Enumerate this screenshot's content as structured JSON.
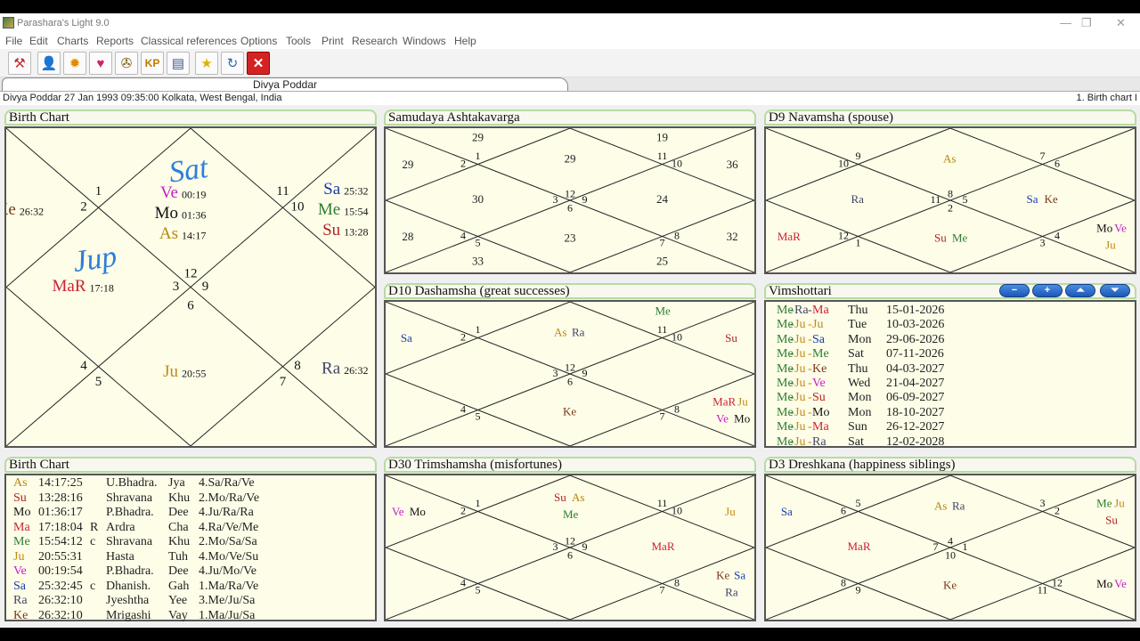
{
  "window": {
    "title": "Parashara's Light 9.0",
    "restore_glyph": "❐",
    "close_glyph": "✕"
  },
  "menu": [
    "File",
    "Edit",
    "Charts",
    "Reports",
    "Classical references",
    "Options",
    "Tools",
    "Print",
    "Research",
    "Windows",
    "Help"
  ],
  "toolbar": [
    {
      "name": "tools-icon",
      "glyph": "⚒"
    },
    {
      "name": "person-icon",
      "glyph": "👤"
    },
    {
      "name": "sun-burst-icon",
      "glyph": "✹"
    },
    {
      "name": "heart-icon",
      "glyph": "♥"
    },
    {
      "name": "wheel-icon",
      "glyph": "✇"
    },
    {
      "name": "kp-icon",
      "glyph": "KP"
    },
    {
      "name": "report-icon",
      "glyph": "▤"
    },
    {
      "name": "star-icon",
      "glyph": "★"
    },
    {
      "name": "refresh-icon",
      "glyph": "↻"
    },
    {
      "name": "close-icon",
      "glyph": "✕"
    }
  ],
  "tab": {
    "label": "Divya Poddar"
  },
  "infobar": {
    "left": "Divya Poddar 27 Jan 1993 09:35:00  Kolkata, West Bengal, India",
    "right": "1. Birth chart I"
  },
  "colors": {
    "As": "#b8860b",
    "Su": "#b22222",
    "Mo": "#111111",
    "Ma": "#cc2233",
    "Me": "#2e7d32",
    "Ju": "#c28a14",
    "Ve": "#c51ec5",
    "Sa": "#1a3aa8",
    "Ra": "#444466",
    "Ke": "#7a3a1a"
  },
  "panels": {
    "birth_chart": {
      "title": "Birth Chart",
      "houses": [
        {
          "h": 1,
          "n": "12"
        },
        {
          "h": 2,
          "n": "1"
        },
        {
          "h": 3,
          "n": "2"
        },
        {
          "h": 4,
          "n": "3"
        },
        {
          "h": 5,
          "n": "4"
        },
        {
          "h": 6,
          "n": "5"
        },
        {
          "h": 7,
          "n": "6"
        },
        {
          "h": 8,
          "n": "7"
        },
        {
          "h": 9,
          "n": "8"
        },
        {
          "h": 10,
          "n": "9"
        },
        {
          "h": 11,
          "n": "10"
        },
        {
          "h": 12,
          "n": "11"
        }
      ],
      "planets": [
        {
          "h": 1,
          "p": "Ve",
          "deg": "00:19"
        },
        {
          "h": 1,
          "p": "Mo",
          "deg": "01:36"
        },
        {
          "h": 1,
          "p": "As",
          "deg": "14:17"
        },
        {
          "h": 3,
          "p": "Ke",
          "deg": "26:32"
        },
        {
          "h": 4,
          "p": "MaR",
          "deg": "17:18",
          "c": "Ma"
        },
        {
          "h": 7,
          "p": "Ju",
          "deg": "20:55"
        },
        {
          "h": 9,
          "p": "Ra",
          "deg": "26:32"
        },
        {
          "h": 11,
          "p": "Sa",
          "deg": "25:32"
        },
        {
          "h": 11,
          "p": "Me",
          "deg": "15:54"
        },
        {
          "h": 11,
          "p": "Su",
          "deg": "13:28"
        }
      ],
      "annotations": [
        "Sat",
        "Jup"
      ]
    },
    "samudaya": {
      "title": "Samudaya Ashtakavarga",
      "houses": [
        {
          "h": 1,
          "n": "12"
        },
        {
          "h": 2,
          "n": "1"
        },
        {
          "h": 3,
          "n": "2"
        },
        {
          "h": 4,
          "n": "3"
        },
        {
          "h": 5,
          "n": "4"
        },
        {
          "h": 6,
          "n": "5"
        },
        {
          "h": 7,
          "n": "6"
        },
        {
          "h": 8,
          "n": "7"
        },
        {
          "h": 9,
          "n": "8"
        },
        {
          "h": 10,
          "n": "9"
        },
        {
          "h": 11,
          "n": "10"
        },
        {
          "h": 12,
          "n": "11"
        }
      ],
      "values": [
        {
          "h": 1,
          "v": "29"
        },
        {
          "h": 2,
          "v": "29"
        },
        {
          "h": 3,
          "v": "29"
        },
        {
          "h": 4,
          "v": "30"
        },
        {
          "h": 5,
          "v": "28"
        },
        {
          "h": 6,
          "v": "33"
        },
        {
          "h": 7,
          "v": "23"
        },
        {
          "h": 8,
          "v": "25"
        },
        {
          "h": 9,
          "v": "32"
        },
        {
          "h": 10,
          "v": "24"
        },
        {
          "h": 11,
          "v": "36"
        },
        {
          "h": 12,
          "v": "19"
        }
      ]
    },
    "d9": {
      "title": "D9 Navamsha  (spouse)",
      "houses": [
        {
          "h": 1,
          "n": "8"
        },
        {
          "h": 2,
          "n": "9"
        },
        {
          "h": 3,
          "n": "10"
        },
        {
          "h": 4,
          "n": "11"
        },
        {
          "h": 5,
          "n": "12"
        },
        {
          "h": 6,
          "n": "1"
        },
        {
          "h": 7,
          "n": "2"
        },
        {
          "h": 8,
          "n": "3"
        },
        {
          "h": 9,
          "n": "4"
        },
        {
          "h": 10,
          "n": "5"
        },
        {
          "h": 11,
          "n": "6"
        },
        {
          "h": 12,
          "n": "7"
        }
      ],
      "planets": [
        {
          "h": 1,
          "items": [
            "As"
          ]
        },
        {
          "h": 4,
          "items": [
            "Ra"
          ]
        },
        {
          "h": 5,
          "items": [
            "MaR"
          ]
        },
        {
          "h": 7,
          "items": [
            "Su",
            "Me"
          ]
        },
        {
          "h": 9,
          "items": [
            "Mo",
            "Ve",
            "Ju"
          ]
        },
        {
          "h": 10,
          "items": [
            "Sa",
            "Ke"
          ]
        }
      ]
    },
    "d10": {
      "title": "D10 Dashamsha  (great successes)",
      "houses": [
        {
          "h": 1,
          "n": "12"
        },
        {
          "h": 2,
          "n": "1"
        },
        {
          "h": 3,
          "n": "2"
        },
        {
          "h": 4,
          "n": "3"
        },
        {
          "h": 5,
          "n": "4"
        },
        {
          "h": 6,
          "n": "5"
        },
        {
          "h": 7,
          "n": "6"
        },
        {
          "h": 8,
          "n": "7"
        },
        {
          "h": 9,
          "n": "8"
        },
        {
          "h": 10,
          "n": "9"
        },
        {
          "h": 11,
          "n": "10"
        },
        {
          "h": 12,
          "n": "11"
        }
      ],
      "planets": [
        {
          "h": 1,
          "items": [
            "As",
            "Ra"
          ]
        },
        {
          "h": 3,
          "items": [
            "Sa"
          ]
        },
        {
          "h": 7,
          "items": [
            "Ke"
          ]
        },
        {
          "h": 9,
          "items": [
            "MaR",
            "Ju",
            "Ve",
            "Mo"
          ]
        },
        {
          "h": 11,
          "items": [
            "Su"
          ]
        },
        {
          "h": 12,
          "items": [
            "Me"
          ]
        }
      ]
    },
    "vimshottari": {
      "title": "Vimshottari",
      "buttons": [
        "−",
        "+",
        "⏶",
        "⏷"
      ],
      "rows": [
        {
          "p": [
            "Me",
            "Ra",
            "Ma"
          ],
          "day": "Thu",
          "date": "15-01-2026"
        },
        {
          "p": [
            "Me",
            "Ju",
            "Ju"
          ],
          "day": "Tue",
          "date": "10-03-2026"
        },
        {
          "p": [
            "Me",
            "Ju",
            "Sa"
          ],
          "day": "Mon",
          "date": "29-06-2026"
        },
        {
          "p": [
            "Me",
            "Ju",
            "Me"
          ],
          "day": "Sat",
          "date": "07-11-2026"
        },
        {
          "p": [
            "Me",
            "Ju",
            "Ke"
          ],
          "day": "Thu",
          "date": "04-03-2027"
        },
        {
          "p": [
            "Me",
            "Ju",
            "Ve"
          ],
          "day": "Wed",
          "date": "21-04-2027"
        },
        {
          "p": [
            "Me",
            "Ju",
            "Su"
          ],
          "day": "Mon",
          "date": "06-09-2027"
        },
        {
          "p": [
            "Me",
            "Ju",
            "Mo"
          ],
          "day": "Mon",
          "date": "18-10-2027"
        },
        {
          "p": [
            "Me",
            "Ju",
            "Ma"
          ],
          "day": "Sun",
          "date": "26-12-2027"
        },
        {
          "p": [
            "Me",
            "Ju",
            "Ra"
          ],
          "day": "Sat",
          "date": "12-02-2028"
        }
      ]
    },
    "positions": {
      "title": "Birth Chart",
      "rows": [
        {
          "p": "As",
          "deg": "14:17:25",
          "flag": "",
          "nak": "U.Bhadra.",
          "lord": "Jya",
          "pada": "4.Sa/Ra/Ve"
        },
        {
          "p": "Su",
          "deg": "13:28:16",
          "flag": "",
          "nak": "Shravana",
          "lord": "Khu",
          "pada": "2.Mo/Ra/Ve"
        },
        {
          "p": "Mo",
          "deg": "01:36:17",
          "flag": "",
          "nak": "P.Bhadra.",
          "lord": "Dee",
          "pada": "4.Ju/Ra/Ra"
        },
        {
          "p": "Ma",
          "deg": "17:18:04",
          "flag": "R",
          "nak": "Ardra",
          "lord": "Cha",
          "pada": "4.Ra/Ve/Me"
        },
        {
          "p": "Me",
          "deg": "15:54:12",
          "flag": "c",
          "nak": "Shravana",
          "lord": "Khu",
          "pada": "2.Mo/Sa/Sa"
        },
        {
          "p": "Ju",
          "deg": "20:55:31",
          "flag": "",
          "nak": "Hasta",
          "lord": "Tuh",
          "pada": "4.Mo/Ve/Su"
        },
        {
          "p": "Ve",
          "deg": "00:19:54",
          "flag": "",
          "nak": "P.Bhadra.",
          "lord": "Dee",
          "pada": "4.Ju/Mo/Ve"
        },
        {
          "p": "Sa",
          "deg": "25:32:45",
          "flag": "c",
          "nak": "Dhanish.",
          "lord": "Gah",
          "pada": "1.Ma/Ra/Ve"
        },
        {
          "p": "Ra",
          "deg": "26:32:10",
          "flag": "",
          "nak": "Jyeshtha",
          "lord": "Yee",
          "pada": "3.Me/Ju/Sa"
        },
        {
          "p": "Ke",
          "deg": "26:32:10",
          "flag": "",
          "nak": "Mrigashi",
          "lord": "Vay",
          "pada": "1.Ma/Ju/Sa"
        }
      ]
    },
    "d30": {
      "title": "D30 Trimshamsha  (misfortunes)",
      "houses": [
        {
          "h": 1,
          "n": "12"
        },
        {
          "h": 2,
          "n": "1"
        },
        {
          "h": 3,
          "n": "2"
        },
        {
          "h": 4,
          "n": "3"
        },
        {
          "h": 5,
          "n": "4"
        },
        {
          "h": 6,
          "n": "5"
        },
        {
          "h": 7,
          "n": "6"
        },
        {
          "h": 8,
          "n": "7"
        },
        {
          "h": 9,
          "n": "8"
        },
        {
          "h": 10,
          "n": "9"
        },
        {
          "h": 11,
          "n": "10"
        },
        {
          "h": 12,
          "n": "11"
        }
      ],
      "planets": [
        {
          "h": 1,
          "items": [
            "Su",
            "As",
            "Me"
          ]
        },
        {
          "h": 3,
          "items": [
            "Ve",
            "Mo"
          ]
        },
        {
          "h": 9,
          "items": [
            "Ke",
            "Sa",
            "Ra"
          ]
        },
        {
          "h": 10,
          "items": [
            "MaR"
          ]
        },
        {
          "h": 11,
          "items": [
            "Ju"
          ]
        }
      ]
    },
    "d3": {
      "title": "D3 Dreshkana  (happiness siblings)",
      "houses": [
        {
          "h": 1,
          "n": "4"
        },
        {
          "h": 2,
          "n": "5"
        },
        {
          "h": 3,
          "n": "6"
        },
        {
          "h": 4,
          "n": "7"
        },
        {
          "h": 5,
          "n": "8"
        },
        {
          "h": 6,
          "n": "9"
        },
        {
          "h": 7,
          "n": "10"
        },
        {
          "h": 8,
          "n": "11"
        },
        {
          "h": 9,
          "n": "12"
        },
        {
          "h": 10,
          "n": "1"
        },
        {
          "h": 11,
          "n": "2"
        },
        {
          "h": 12,
          "n": "3"
        }
      ],
      "planets": [
        {
          "h": 1,
          "items": [
            "As",
            "Ra"
          ]
        },
        {
          "h": 3,
          "items": [
            "Sa"
          ]
        },
        {
          "h": 4,
          "items": [
            "MaR"
          ]
        },
        {
          "h": 7,
          "items": [
            "Ke"
          ]
        },
        {
          "h": 9,
          "items": [
            "Mo",
            "Ve"
          ]
        },
        {
          "h": 11,
          "items": [
            "Me",
            "Ju",
            "Su"
          ]
        }
      ]
    }
  }
}
